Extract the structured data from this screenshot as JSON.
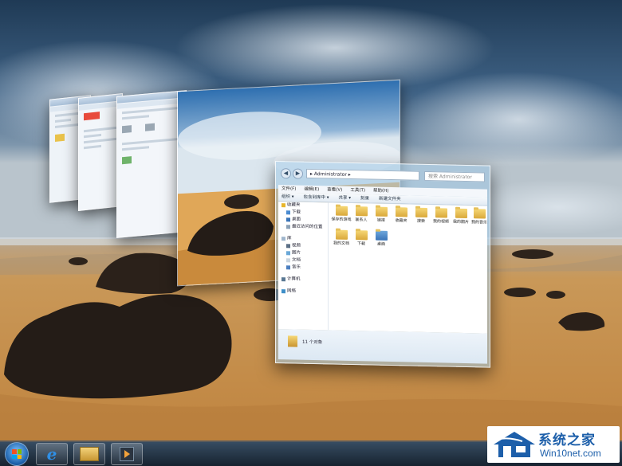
{
  "colors": {
    "sky": "#2b4660",
    "sand": "#c8924a",
    "glass": "#a0c8e6",
    "watermark_blue": "#1d5faa"
  },
  "flip3d": {
    "windows": [
      {
        "name": "ie-window-back-1"
      },
      {
        "name": "ie-window-back-2"
      },
      {
        "name": "computer-window-back-3"
      },
      {
        "name": "desktop-wallpaper-preview"
      }
    ]
  },
  "explorer": {
    "address": "▸ Administrator ▸",
    "search_placeholder": "搜索 Administrator",
    "menu": [
      "文件(F)",
      "编辑(E)",
      "查看(V)",
      "工具(T)",
      "帮助(H)"
    ],
    "toolbar": [
      "组织 ▾",
      "包含到库中 ▾",
      "共享 ▾",
      "刻录",
      "新建文件夹"
    ],
    "nav_pane": {
      "favorites": {
        "label": "收藏夹",
        "items": [
          "下载",
          "桌面",
          "最近访问的位置"
        ]
      },
      "libraries": {
        "label": "库",
        "items": [
          "视频",
          "图片",
          "文档",
          "音乐"
        ]
      },
      "computer": "计算机",
      "network": "网络"
    },
    "files": [
      "保存的游戏",
      "联系人",
      "链接",
      "收藏夹",
      "搜索",
      "我的视频",
      "我的图片",
      "我的音乐",
      "我的文档",
      "下载",
      "桌面"
    ],
    "status": "11 个对象"
  },
  "taskbar": {
    "icons": [
      "windows-start-orb",
      "internet-explorer",
      "windows-explorer",
      "windows-media-player"
    ]
  },
  "watermark": {
    "name": "系统之家",
    "url": "Win10net.com"
  }
}
